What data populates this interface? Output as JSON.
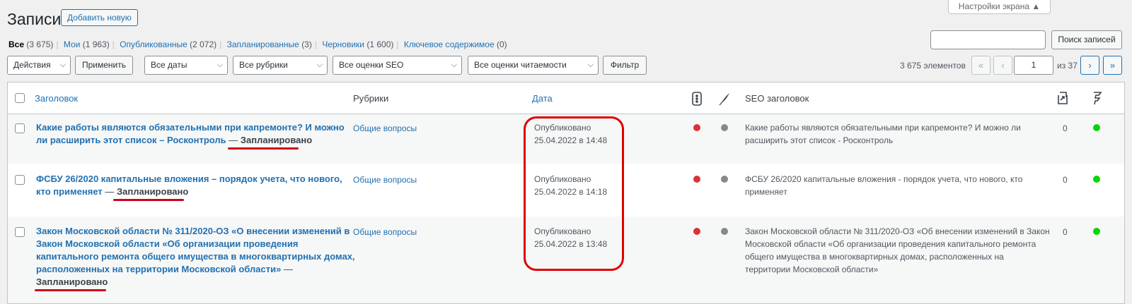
{
  "header": {
    "title": "Записи",
    "add_new": "Добавить новую",
    "screen_options": "Настройки экрана ▲"
  },
  "views": [
    {
      "label": "Все",
      "count": "(3 675)"
    },
    {
      "label": "Мои",
      "count": "(1 963)"
    },
    {
      "label": "Опубликованные",
      "count": "(2 072)"
    },
    {
      "label": "Запланированные",
      "count": "(3)"
    },
    {
      "label": "Черновики",
      "count": "(1 600)"
    },
    {
      "label": "Ключевое содержимое",
      "count": "(0)"
    }
  ],
  "search": {
    "value": "",
    "button": "Поиск записей"
  },
  "toolbar": {
    "bulk_action": "Действия",
    "apply": "Применить",
    "dates": "Все даты",
    "categories": "Все рубрики",
    "seo_scores": "Все оценки SEO",
    "readability": "Все оценки читаемости",
    "filter": "Фильтр"
  },
  "pagination": {
    "items": "3 675 элементов",
    "first": "«",
    "prev": "‹",
    "current": "1",
    "of": "из 37",
    "next": "›",
    "last": "»"
  },
  "table": {
    "columns": {
      "title": "Заголовок",
      "categories": "Рубрики",
      "date": "Дата",
      "seo_title": "SEO заголовок"
    },
    "rows": [
      {
        "title_l1": "Какие работы являются обязательными при капремонте? И можно",
        "title_l2": "ли расширить этот список – Росконтроль",
        "dash": "—",
        "state": "Запланировано",
        "category": "Общие вопросы",
        "date_status": "Опубликовано",
        "date_value": "25.04.2022 в 14:48",
        "seo_l1": "Какие работы являются обязательными при капремонте? И можно ли",
        "seo_l2": "расширить этот список - Росконтроль",
        "links": "0"
      },
      {
        "title_l1": "ФСБУ 26/2020 капитальные вложения – порядок учета, что нового,",
        "title_l2": "кто применяет",
        "dash": "—",
        "state": "Запланировано",
        "category": "Общие вопросы",
        "date_status": "Опубликовано",
        "date_value": "25.04.2022 в 14:18",
        "seo_l1": "ФСБУ 26/2020 капитальные вложения - порядок учета, что нового, кто",
        "seo_l2": "применяет",
        "links": "0"
      },
      {
        "title_l1": "Закон Московской области № 311/2020-ОЗ «О внесении изменений в",
        "title_l2": "Закон Московской области «Об организации проведения",
        "title_l3": "капитального ремонта общего имущества в многоквартирных домах,",
        "title_l4": "расположенных на территории Московской области»",
        "dash": "—",
        "state": "Запланировано",
        "category": "Общие вопросы",
        "date_status": "Опубликовано",
        "date_value": "25.04.2022 в 13:48",
        "seo_l1": "Закон Московской области № 311/2020-ОЗ «Об внесении изменений в Закон",
        "seo_l2": "Московской области «Об организации проведения капитального ремонта",
        "seo_l3": "общего имущества в многоквартирных домах, расположенных на",
        "seo_l4": "территории Московской области»",
        "links": "0"
      }
    ]
  },
  "colors": {
    "seo_red": "#dc3232",
    "readability_gray": "#888888",
    "green": "#00d600",
    "annotation": "#e00000"
  }
}
